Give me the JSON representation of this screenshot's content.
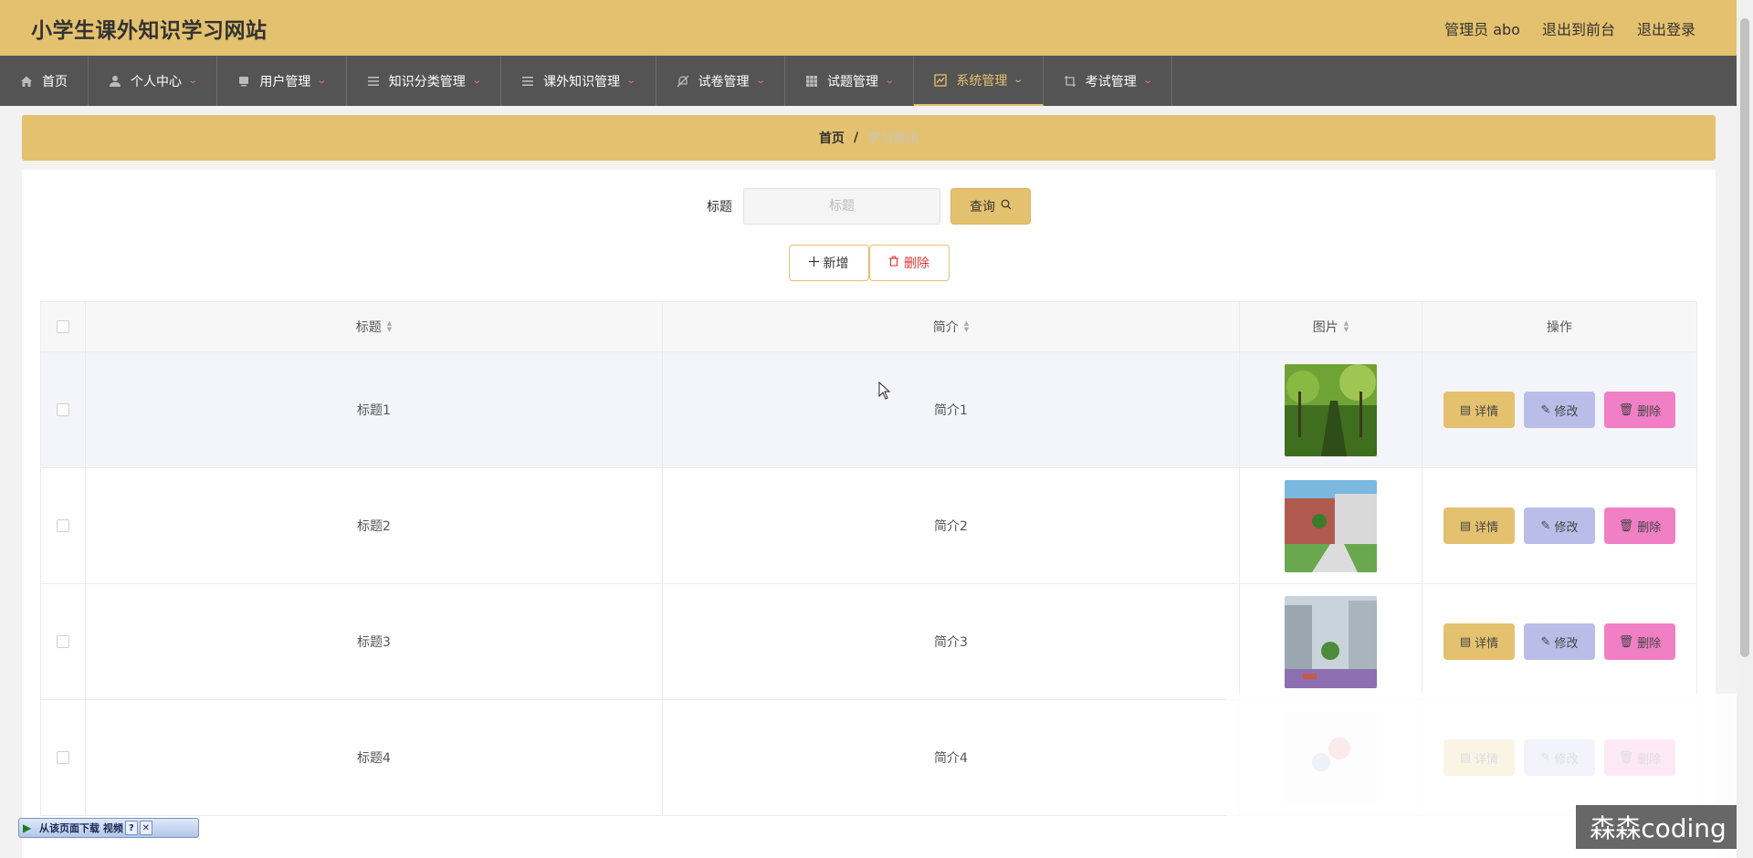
{
  "header": {
    "title": "小学生课外知识学习网站",
    "admin": "管理员 abo",
    "to_front": "退出到前台",
    "logout": "退出登录"
  },
  "nav": [
    {
      "label": "首页",
      "icon": "home-icon"
    },
    {
      "label": "个人中心",
      "icon": "user-icon"
    },
    {
      "label": "用户管理",
      "icon": "users-icon"
    },
    {
      "label": "知识分类管理",
      "icon": "list-icon"
    },
    {
      "label": "课外知识管理",
      "icon": "list-icon"
    },
    {
      "label": "试卷管理",
      "icon": "bell-off-icon"
    },
    {
      "label": "试题管理",
      "icon": "grid-icon"
    },
    {
      "label": "系统管理",
      "icon": "chart-icon"
    },
    {
      "label": "考试管理",
      "icon": "crop-icon"
    }
  ],
  "breadcrumb": {
    "home": "首页",
    "separator": "/",
    "current": "学习资讯"
  },
  "search": {
    "label": "标题",
    "placeholder": "标题",
    "button": "查询"
  },
  "actions": {
    "add": "新增",
    "delete": "删除"
  },
  "table": {
    "headers": {
      "title": "标题",
      "intro": "简介",
      "image": "图片",
      "operation": "操作"
    },
    "rows": [
      {
        "title": "标题1",
        "intro": "简介1"
      },
      {
        "title": "标题2",
        "intro": "简介2"
      },
      {
        "title": "标题3",
        "intro": "简介3"
      },
      {
        "title": "标题4",
        "intro": "简介4"
      }
    ],
    "op_labels": {
      "detail": "详情",
      "edit": "修改",
      "delete": "删除"
    }
  },
  "overlay": {
    "watermark": "森森coding",
    "download_bar": "从该页面下载 视频"
  },
  "colors": {
    "accent": "#e4c16e",
    "nav_bg": "#545454",
    "edit_btn": "#b9bde8",
    "delete_btn": "#f07fc5"
  }
}
